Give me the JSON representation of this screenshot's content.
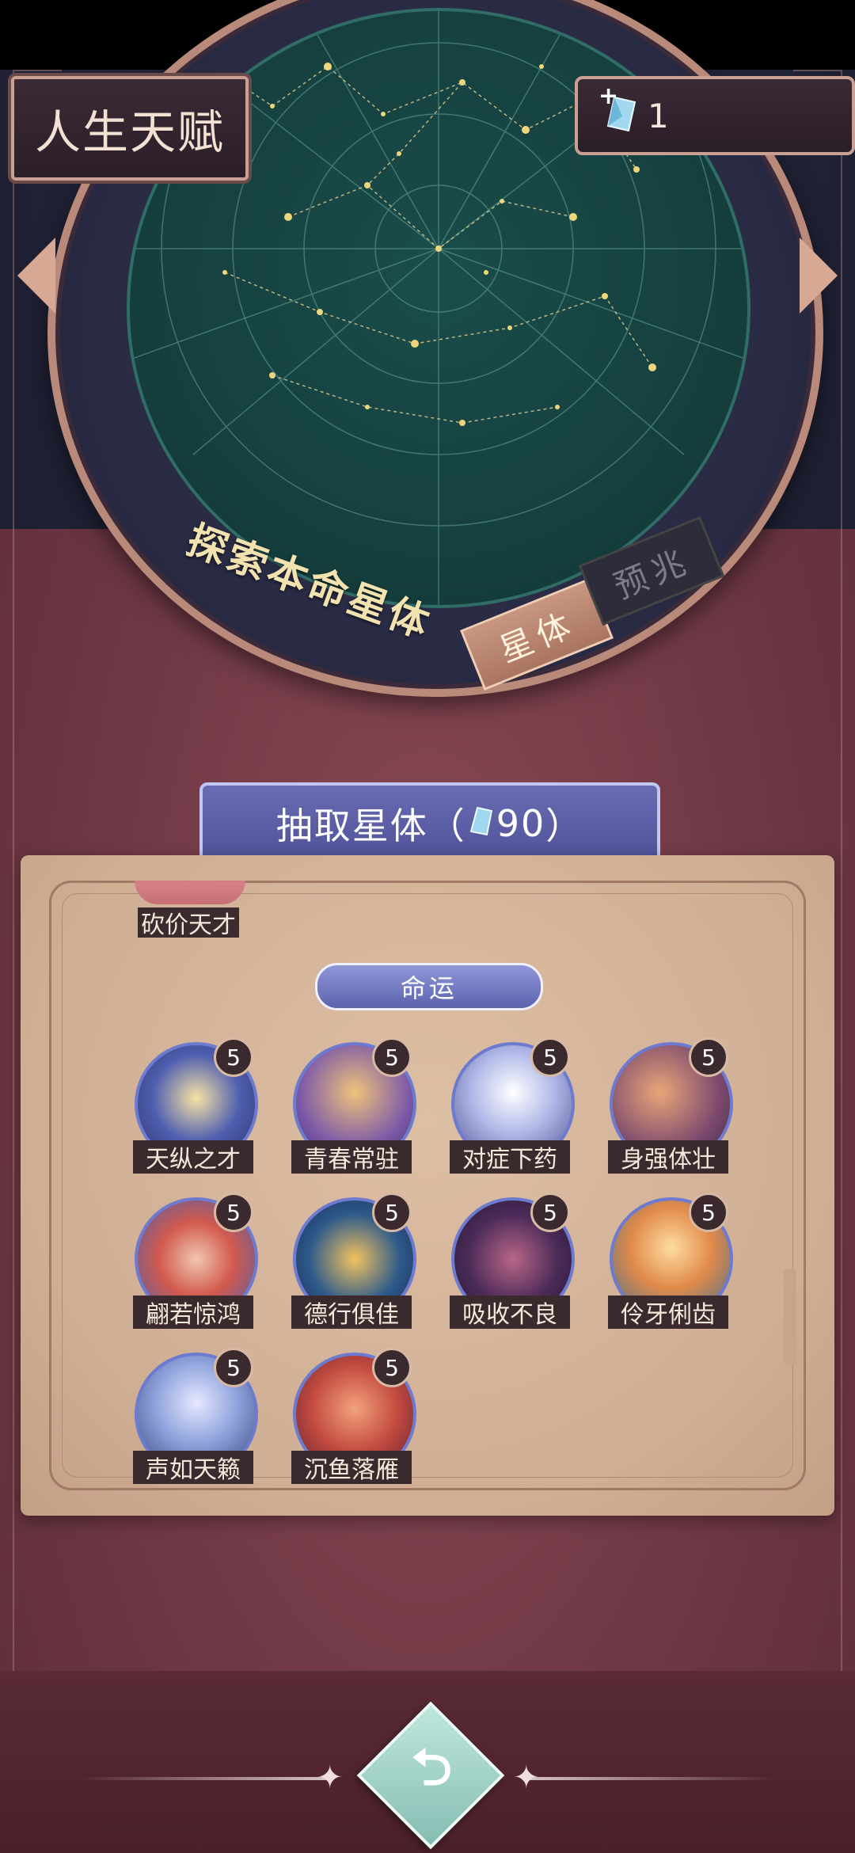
{
  "header": {
    "title": "人生天赋",
    "crystal_count": "1"
  },
  "wheel": {
    "explore_text": "探索本命星体",
    "tabs": [
      "星体",
      "预兆"
    ]
  },
  "draw_button": {
    "label_prefix": "抽取星体（",
    "cost": "90",
    "label_suffix": "）"
  },
  "panel": {
    "partial_item": "砍价天才",
    "category": "命运",
    "talents": [
      {
        "name": "天纵之才",
        "level": "5"
      },
      {
        "name": "青春常驻",
        "level": "5"
      },
      {
        "name": "对症下药",
        "level": "5"
      },
      {
        "name": "身强体壮",
        "level": "5"
      },
      {
        "name": "翩若惊鸿",
        "level": "5"
      },
      {
        "name": "德行俱佳",
        "level": "5"
      },
      {
        "name": "吸收不良",
        "level": "5"
      },
      {
        "name": "伶牙俐齿",
        "level": "5"
      },
      {
        "name": "声如天籁",
        "level": "5"
      },
      {
        "name": "沉鱼落雁",
        "level": "5"
      }
    ]
  },
  "icons": {
    "crystal": "crystal-gem-icon",
    "back": "back-arrow-icon"
  },
  "colors": {
    "accent": "#5c63ad",
    "panel": "#cfae94",
    "background": "#6f3845"
  }
}
